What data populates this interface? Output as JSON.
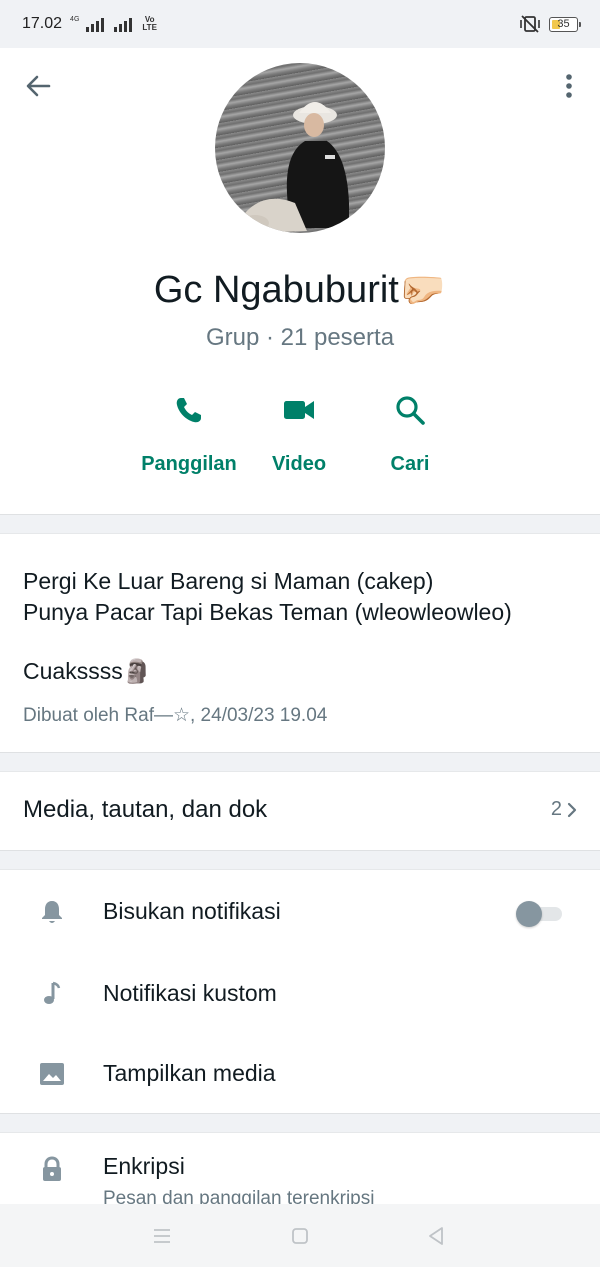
{
  "status_bar": {
    "time": "17.02",
    "signal_label": "4G",
    "volte_label_1": "Vo",
    "volte_label_2": "LTE",
    "battery_level": "35"
  },
  "header": {
    "group_name": "Gc Ngabuburit🤛🏻",
    "group_meta": "Grup · 21 peserta",
    "actions": [
      {
        "label": "Panggilan",
        "icon": "phone-icon"
      },
      {
        "label": "Video",
        "icon": "video-icon"
      },
      {
        "label": "Cari",
        "icon": "search-icon"
      }
    ]
  },
  "description": {
    "line1": "Pergi Ke Luar Bareng si Maman (cakep)",
    "line2": "Punya Pacar Tapi Bekas Teman (wleowleowleo)",
    "line3": "Cuakssss🗿",
    "created": "Dibuat oleh Raf—☆, 24/03/23 19.04"
  },
  "media": {
    "label": "Media, tautan, dan dok",
    "count": "2"
  },
  "settings": {
    "mute_label": "Bisukan notifikasi",
    "mute_enabled": false,
    "custom_notif_label": "Notifikasi kustom",
    "show_media_label": "Tampilkan media"
  },
  "encryption": {
    "label": "Enkripsi",
    "sub": "Pesan dan panggilan terenkripsi"
  },
  "colors": {
    "accent": "#008069",
    "icon_grey": "#8696a0",
    "text_secondary": "#667781"
  }
}
